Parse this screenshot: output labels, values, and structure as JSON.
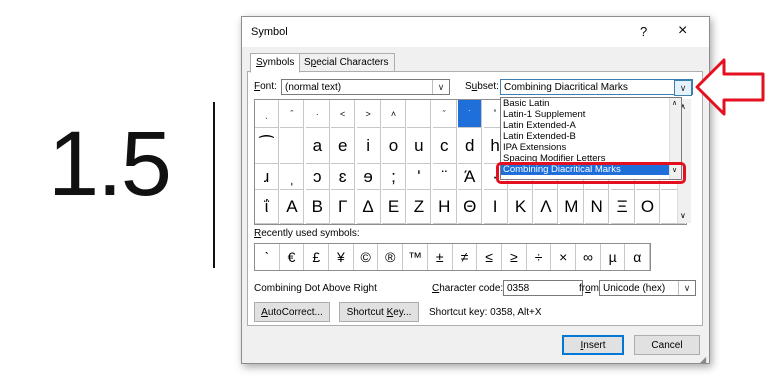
{
  "document": {
    "text": "1.5"
  },
  "dialog": {
    "title": "Symbol",
    "help": "?",
    "close": "×",
    "tabs": [
      {
        "pre": "",
        "key": "S",
        "post": "ymbols"
      },
      {
        "pre": "S",
        "key": "p",
        "post": "ecial Characters"
      }
    ],
    "font": {
      "label_key": "F",
      "label_rest": "ont:",
      "value": "(normal text)"
    },
    "subset": {
      "label_pre": "S",
      "label_key": "u",
      "label_rest": "bset:",
      "value": "Combining Diacritical Marks"
    },
    "subset_options": [
      "Basic Latin",
      "Latin-1 Supplement",
      "Latin Extended-A",
      "Latin Extended-B",
      "IPA Extensions",
      "Spacing Modifier Letters",
      "Combining Diacritical Marks"
    ],
    "grid_rows": [
      [
        "ˎ",
        "ˆ",
        "·",
        "˂",
        "˃",
        "˄",
        "",
        "ˇ",
        "˙",
        "˚",
        "",
        "",
        "",
        "",
        "",
        "",
        ""
      ],
      [
        "⁀",
        "",
        "a",
        "e",
        "i",
        "o",
        "u",
        "c",
        "d",
        "h",
        "",
        "",
        "",
        "",
        "",
        "",
        ""
      ],
      [
        "ɹ",
        "ˌ",
        "ɔ",
        "ɛ",
        "ɘ",
        ";",
        "ʹ",
        "̈",
        "Ά",
        "·",
        "",
        "",
        "",
        "",
        "",
        "",
        ""
      ],
      [
        "ΐ",
        "Α",
        "Β",
        "Γ",
        "Δ",
        "Ε",
        "Ζ",
        "Η",
        "Θ",
        "Ι",
        "Κ",
        "Λ",
        "Μ",
        "Ν",
        "Ξ",
        "Ο",
        ""
      ]
    ],
    "recent_label_key": "R",
    "recent_label_rest": "ecently used symbols:",
    "recent_symbols": [
      "ˋ",
      "€",
      "£",
      "¥",
      "©",
      "®",
      "™",
      "±",
      "≠",
      "≤",
      "≥",
      "÷",
      "×",
      "∞",
      "µ",
      "α"
    ],
    "char_name": "Combining Dot Above Right",
    "char_code": {
      "label_key": "C",
      "label_rest": "haracter code:",
      "value": "0358"
    },
    "from": {
      "label_pre": "fr",
      "label_key": "o",
      "label_rest": "m:",
      "value": "Unicode (hex)"
    },
    "autocorrect": {
      "pre": "",
      "key": "A",
      "post": "utoCorrect..."
    },
    "shortcut_key": {
      "pre": "Shortcut ",
      "key": "K",
      "post": "ey..."
    },
    "shortcut_text": "Shortcut key: 0358, Alt+X",
    "insert": {
      "key": "I",
      "post": "nsert"
    },
    "cancel": "Cancel"
  },
  "colors": {
    "highlight": "#1e6fd9",
    "annotation": "#e4101f"
  }
}
